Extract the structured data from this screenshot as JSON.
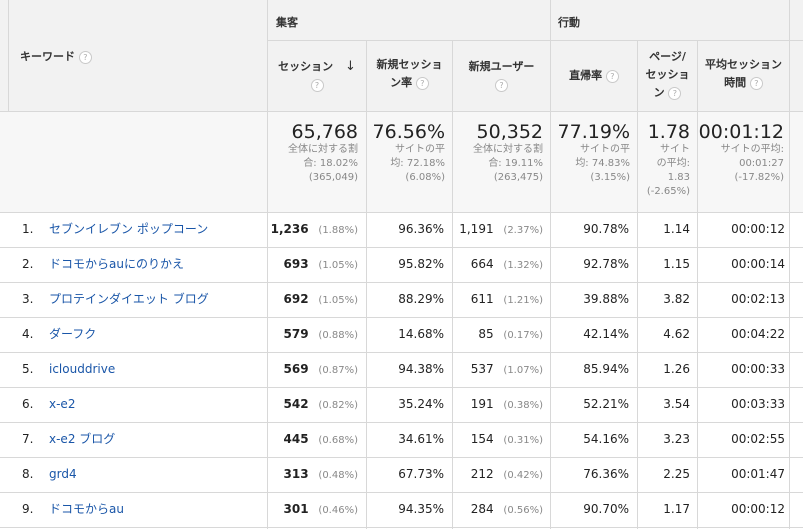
{
  "groups": {
    "acquisition": "集客",
    "behavior": "行動"
  },
  "columns": {
    "keyword": "キーワード",
    "sessions": "セッション",
    "new_session_rate_1": "新規セッショ",
    "new_session_rate_2": "ン率",
    "new_users": "新規ユーザー",
    "bounce_rate": "直帰率",
    "pages_1": "ページ/",
    "pages_2": "セッショ",
    "pages_3": "ン",
    "avg_duration_1": "平均セッション",
    "avg_duration_2": "時間",
    "help_glyph": "?",
    "sort_arrow": "↓"
  },
  "totals": {
    "sessions": {
      "value": "65,768",
      "l1": "全体に対する割",
      "l2": "合: 18.02%",
      "l3": "(365,049)"
    },
    "new_session_rate": {
      "value": "76.56%",
      "l1": "サイトの平",
      "l2": "均: 72.18%",
      "l3": "(6.08%)"
    },
    "new_users": {
      "value": "50,352",
      "l1": "全体に対する割",
      "l2": "合: 19.11%",
      "l3": "(263,475)"
    },
    "bounce_rate": {
      "value": "77.19%",
      "l1": "サイトの平",
      "l2": "均: 74.83%",
      "l3": "(3.15%)"
    },
    "pages": {
      "value": "1.78",
      "l1": "サイト",
      "l2": "の平均:",
      "l3": "1.83",
      "l4": "(-2.65%)"
    },
    "avg_duration": {
      "value": "00:01:12",
      "l1": "サイトの平均:",
      "l2": "00:01:27",
      "l3": "(-17.82%)"
    }
  },
  "rows": [
    {
      "idx": "1.",
      "keyword": "セブンイレブン ポップコーン",
      "sessions": "1,236",
      "sessions_pct": "(1.88%)",
      "new_rate": "96.36%",
      "new_users": "1,191",
      "new_users_pct": "(2.37%)",
      "bounce": "90.78%",
      "pages": "1.14",
      "duration": "00:00:12"
    },
    {
      "idx": "2.",
      "keyword": "ドコモからauにのりかえ",
      "sessions": "693",
      "sessions_pct": "(1.05%)",
      "new_rate": "95.82%",
      "new_users": "664",
      "new_users_pct": "(1.32%)",
      "bounce": "92.78%",
      "pages": "1.15",
      "duration": "00:00:14"
    },
    {
      "idx": "3.",
      "keyword": "プロテインダイエット ブログ",
      "sessions": "692",
      "sessions_pct": "(1.05%)",
      "new_rate": "88.29%",
      "new_users": "611",
      "new_users_pct": "(1.21%)",
      "bounce": "39.88%",
      "pages": "3.82",
      "duration": "00:02:13"
    },
    {
      "idx": "4.",
      "keyword": "ダーフク",
      "sessions": "579",
      "sessions_pct": "(0.88%)",
      "new_rate": "14.68%",
      "new_users": "85",
      "new_users_pct": "(0.17%)",
      "bounce": "42.14%",
      "pages": "4.62",
      "duration": "00:04:22"
    },
    {
      "idx": "5.",
      "keyword": "iclouddrive",
      "sessions": "569",
      "sessions_pct": "(0.87%)",
      "new_rate": "94.38%",
      "new_users": "537",
      "new_users_pct": "(1.07%)",
      "bounce": "85.94%",
      "pages": "1.26",
      "duration": "00:00:33"
    },
    {
      "idx": "6.",
      "keyword": "x-e2",
      "sessions": "542",
      "sessions_pct": "(0.82%)",
      "new_rate": "35.24%",
      "new_users": "191",
      "new_users_pct": "(0.38%)",
      "bounce": "52.21%",
      "pages": "3.54",
      "duration": "00:03:33"
    },
    {
      "idx": "7.",
      "keyword": "x-e2 ブログ",
      "sessions": "445",
      "sessions_pct": "(0.68%)",
      "new_rate": "34.61%",
      "new_users": "154",
      "new_users_pct": "(0.31%)",
      "bounce": "54.16%",
      "pages": "3.23",
      "duration": "00:02:55"
    },
    {
      "idx": "8.",
      "keyword": "grd4",
      "sessions": "313",
      "sessions_pct": "(0.48%)",
      "new_rate": "67.73%",
      "new_users": "212",
      "new_users_pct": "(0.42%)",
      "bounce": "76.36%",
      "pages": "2.25",
      "duration": "00:01:47"
    },
    {
      "idx": "9.",
      "keyword": "ドコモからau",
      "sessions": "301",
      "sessions_pct": "(0.46%)",
      "new_rate": "94.35%",
      "new_users": "284",
      "new_users_pct": "(0.56%)",
      "bounce": "90.70%",
      "pages": "1.17",
      "duration": "00:00:12"
    }
  ]
}
